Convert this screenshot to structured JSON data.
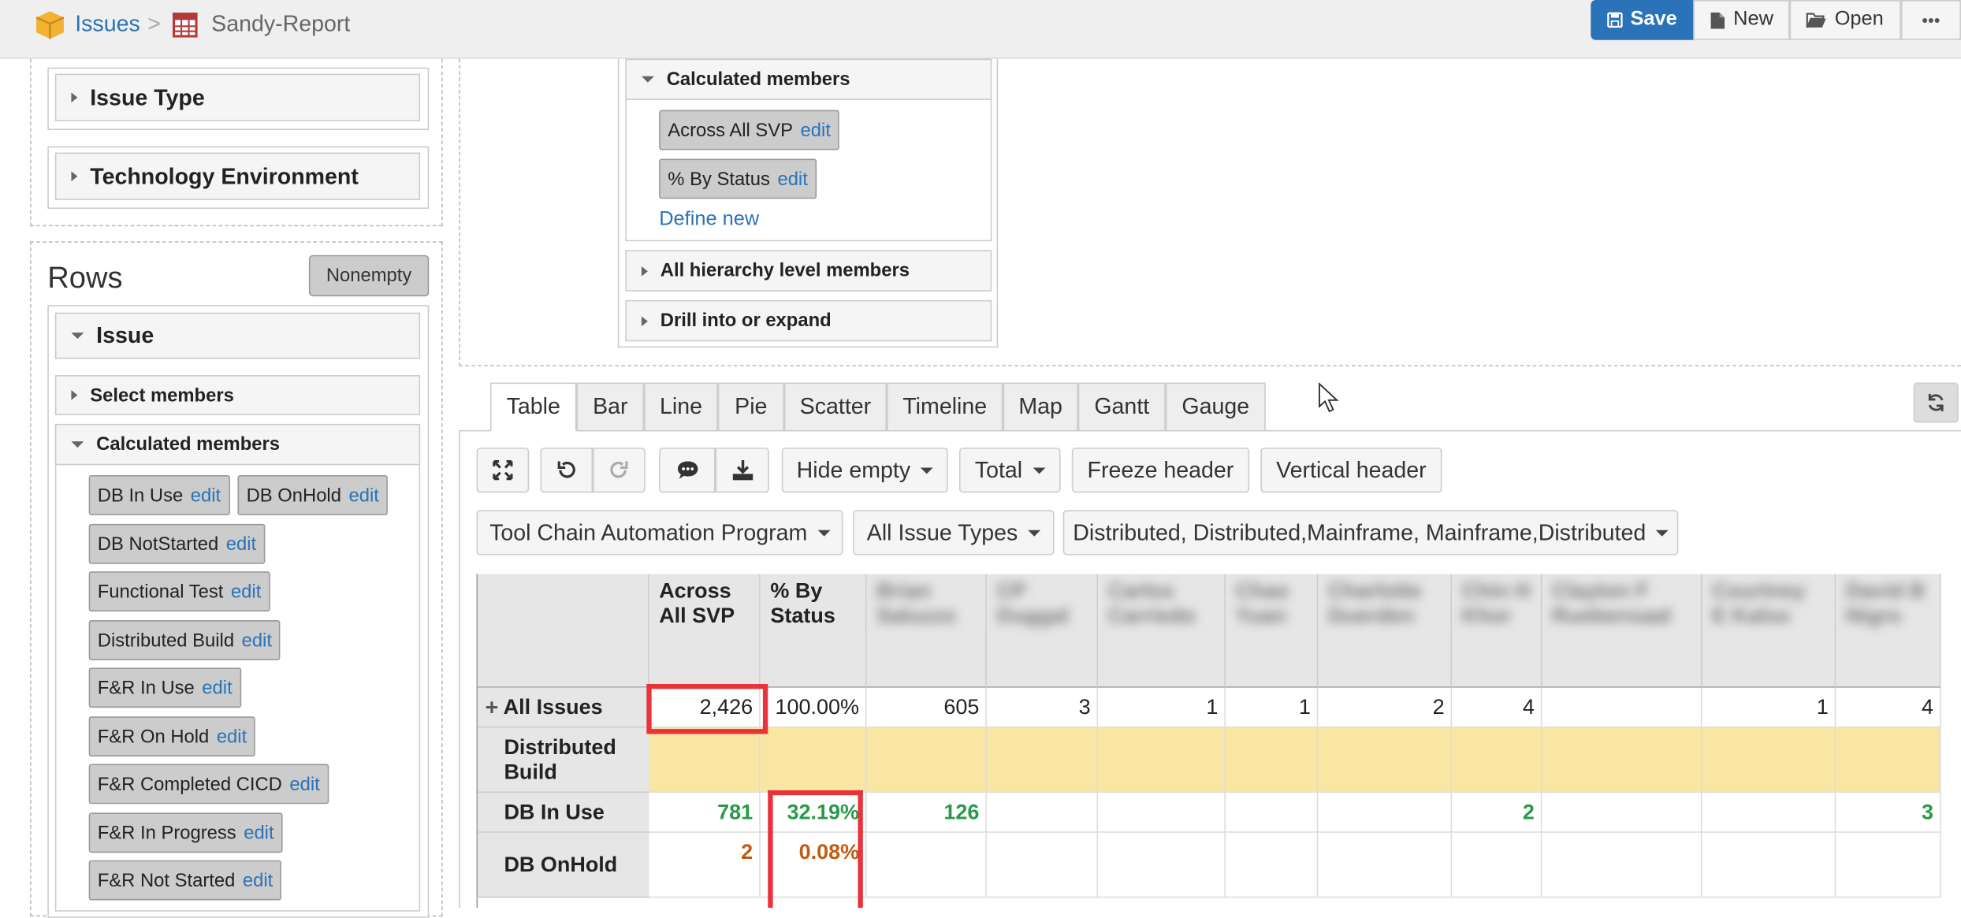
{
  "topbar": {
    "breadcrumb_root": "Issues",
    "breadcrumb_sep": ">",
    "report_name": "Sandy-Report",
    "save_label": "Save",
    "new_label": "New",
    "open_label": "Open",
    "more_label": "•••"
  },
  "left": {
    "issue_type": "Issue Type",
    "tech_env": "Technology Environment",
    "rows_title": "Rows",
    "nonempty_label": "Nonempty",
    "issue_label": "Issue",
    "select_members": "Select members",
    "calc_members": "Calculated members",
    "edit_label": "edit",
    "chips": [
      "DB In Use",
      "DB OnHold",
      "DB NotStarted",
      "Functional Test",
      "Distributed Build",
      "F&R In Use",
      "F&R On Hold",
      "F&R Completed CICD",
      "F&R In Progress",
      "F&R Not Started"
    ]
  },
  "columns_panel": {
    "calc_members": "Calculated members",
    "chip1": "Across All SVP",
    "chip2": "% By Status",
    "edit_label": "edit",
    "define_new": "Define new",
    "all_hierarchy": "All hierarchy level members",
    "drill": "Drill into or expand"
  },
  "tabs": [
    "Table",
    "Bar",
    "Line",
    "Pie",
    "Scatter",
    "Timeline",
    "Map",
    "Gantt",
    "Gauge"
  ],
  "toolbar": {
    "hide_empty": "Hide empty",
    "total": "Total",
    "freeze_header": "Freeze header",
    "vertical_header": "Vertical header"
  },
  "filters": {
    "project": "Tool Chain Automation Program",
    "issue_types": "All Issue Types",
    "env": "Distributed, Distributed,Mainframe, Mainframe,Distributed"
  },
  "table": {
    "headers": [
      "Across All SVP",
      "% By Status",
      "Brian Saluzzo",
      "CP Duggal",
      "Carlos Carriedo",
      "Chao Yuan",
      "Charlotte Duerden",
      "Chin H Khor",
      "Clayton F Ruebensaal",
      "Courtney E Kalso",
      "David B Nigro"
    ],
    "rows": [
      {
        "label": "All Issues",
        "values": [
          "2,426",
          "100.00%",
          "605",
          "3",
          "1",
          "1",
          "2",
          "4",
          "",
          "1",
          "4"
        ]
      },
      {
        "label": "Distributed Build",
        "values": [
          "",
          "",
          "",
          "",
          "",
          "",
          "",
          "",
          "",
          "",
          ""
        ]
      },
      {
        "label": "DB In Use",
        "values": [
          "781",
          "32.19%",
          "126",
          "",
          "",
          "",
          "",
          "2",
          "",
          "",
          "3"
        ]
      },
      {
        "label": "DB OnHold",
        "values": [
          "2",
          "0.08%",
          "",
          "",
          "",
          "",
          "",
          "",
          "",
          "",
          ""
        ]
      }
    ]
  }
}
